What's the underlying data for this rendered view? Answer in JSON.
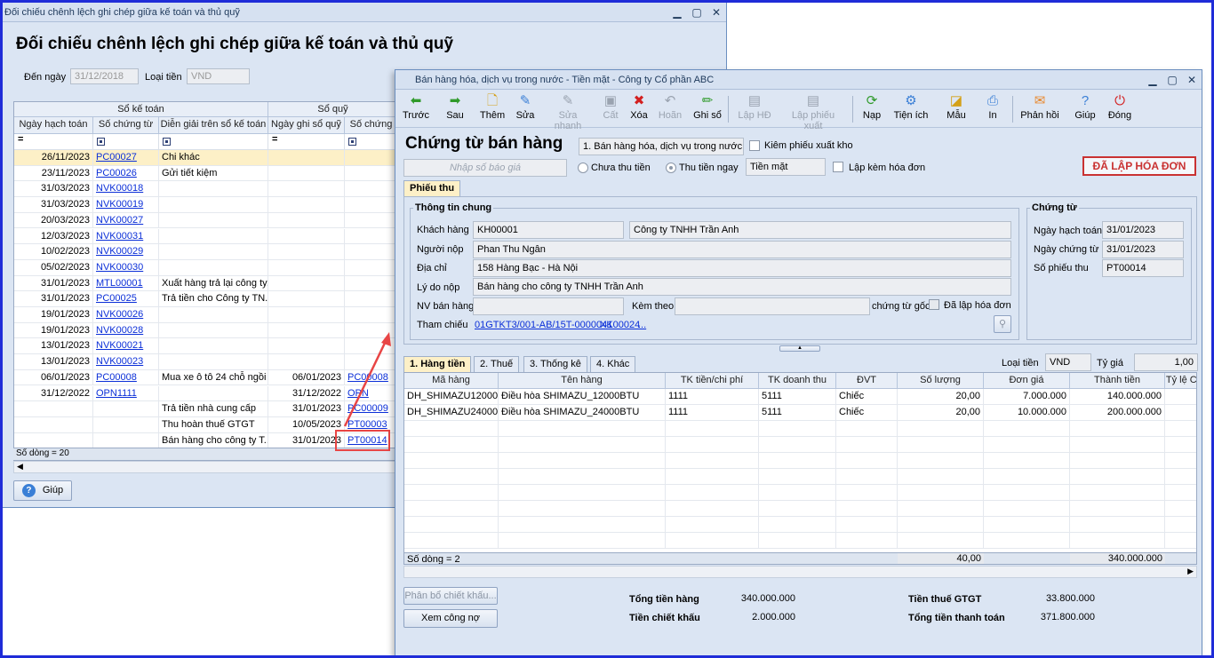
{
  "win1": {
    "title": "Đối chiếu chênh lệch ghi chép giữa kế toán và thủ quỹ",
    "heading": "Đối chiếu chênh lệch ghi chép giữa kế toán và thủ quỹ",
    "to_date_label": "Đến ngày",
    "to_date": "31/12/2018",
    "currency_label": "Loại tiền",
    "currency": "VND",
    "group_accounting": "Sổ kế toán",
    "group_cash": "Sổ quỹ",
    "columns": [
      "Ngày hạch toán",
      "Số chứng từ",
      "Diễn giải trên sổ kế toán",
      "Ngày ghi sổ quỹ",
      "Số chứng"
    ],
    "rows": [
      [
        "26/11/2023",
        "PC00027",
        "Chi khác",
        "",
        ""
      ],
      [
        "23/11/2023",
        "PC00026",
        "Gửi tiết kiệm",
        "",
        ""
      ],
      [
        "31/03/2023",
        "NVK00018",
        "",
        "",
        ""
      ],
      [
        "31/03/2023",
        "NVK00019",
        "",
        "",
        ""
      ],
      [
        "20/03/2023",
        "NVK00027",
        "",
        "",
        ""
      ],
      [
        "12/03/2023",
        "NVK00031",
        "",
        "",
        ""
      ],
      [
        "10/02/2023",
        "NVK00029",
        "",
        "",
        ""
      ],
      [
        "05/02/2023",
        "NVK00030",
        "",
        "",
        ""
      ],
      [
        "31/01/2023",
        "MTL00001",
        "Xuất hàng trả lại công ty...",
        "",
        ""
      ],
      [
        "31/01/2023",
        "PC00025",
        "Trả tiền cho Công ty TN...",
        "",
        ""
      ],
      [
        "19/01/2023",
        "NVK00026",
        "",
        "",
        ""
      ],
      [
        "19/01/2023",
        "NVK00028",
        "",
        "",
        ""
      ],
      [
        "13/01/2023",
        "NVK00021",
        "",
        "",
        ""
      ],
      [
        "13/01/2023",
        "NVK00023",
        "",
        "",
        ""
      ],
      [
        "06/01/2023",
        "PC00008",
        "Mua xe ô tô 24 chỗ ngồi",
        "06/01/2023",
        "PC00008"
      ],
      [
        "31/12/2022",
        "OPN1111",
        "",
        "31/12/2022",
        "OPN"
      ],
      [
        "",
        "",
        "Trả tiền nhà cung cấp",
        "31/01/2023",
        "PC00009"
      ],
      [
        "",
        "",
        "Thu hoàn thuế GTGT",
        "10/05/2023",
        "PT00003"
      ],
      [
        "",
        "",
        "Bán hàng cho công ty T...",
        "31/01/2023",
        "PT00014"
      ]
    ],
    "row_count": "Số dòng = 20",
    "help": "Giúp"
  },
  "win2": {
    "title": "Bán hàng hóa, dịch vụ trong nước - Tiền mặt - Công ty Cổ phần ABC",
    "toolbar": [
      "Trước",
      "Sau",
      "Thêm",
      "Sửa",
      "Sửa nhanh",
      "Cất",
      "Xóa",
      "Hoãn",
      "Ghi sổ",
      "Lập HĐ",
      "Lập phiếu xuất",
      "Nạp",
      "Tiện ích",
      "Mẫu",
      "In",
      "Phản hồi",
      "Giúp",
      "Đóng"
    ],
    "heading": "Chứng từ bán hàng",
    "type": "1. Bán hàng hóa, dịch vụ trong nước",
    "chk_export": "Kiêm phiếu xuất kho",
    "quote_placeholder": "Nhập số báo giá",
    "opt_unpaid": "Chưa thu tiền",
    "opt_paid": "Thu tiền ngay",
    "pay_method": "Tiền mặt",
    "chk_invoice": "Lập kèm hóa đơn",
    "badge": "ĐÃ LẬP HÓA ĐƠN",
    "tab_receipt": "Phiếu thu",
    "general_info": "Thông tin chung",
    "voucher": "Chứng từ",
    "customer_label": "Khách hàng",
    "customer_code": "KH00001",
    "customer_name": "Công ty TNHH Trần Anh",
    "payer_label": "Người nộp",
    "payer": "Phan Thu Ngân",
    "address_label": "Địa chỉ",
    "address": "158 Hàng Bạc - Hà Nội",
    "reason_label": "Lý do nộp",
    "reason": "Bán hàng cho công ty TNHH Trần Anh",
    "seller_label": "NV bán hàng",
    "attach_label": "Kèm theo",
    "orig_doc": "chứng từ gốc",
    "invoiced": "Đã lập hóa đơn",
    "ref_label": "Tham chiếu",
    "ref1": "01GTKT3/001-AB/15T-0000041",
    "ref2": "XK00024",
    "ref3": "...",
    "post_date_label": "Ngày hạch toán",
    "post_date": "31/01/2023",
    "doc_date_label": "Ngày chứng từ",
    "doc_date": "31/01/2023",
    "rec_no_label": "Số phiếu thu",
    "rec_no": "PT00014",
    "tabs": [
      "1. Hàng tiền",
      "2. Thuế",
      "3. Thống kê",
      "4. Khác"
    ],
    "cur_label": "Loại tiền",
    "cur": "VND",
    "rate_label": "Tỷ giá",
    "rate": "1,00",
    "columns": [
      "Mã hàng",
      "Tên hàng",
      "TK tiền/chi phí",
      "TK doanh thu",
      "ĐVT",
      "Số lượng",
      "Đơn giá",
      "Thành tiền",
      "Tỷ lệ Cl"
    ],
    "items": [
      [
        "DH_SHIMAZU12000",
        "Điều hòa SHIMAZU_12000BTU",
        "1111",
        "5111",
        "Chiếc",
        "20,00",
        "7.000.000",
        "140.000.000",
        ""
      ],
      [
        "DH_SHIMAZU24000",
        "Điều hòa SHIMAZU_24000BTU",
        "1111",
        "5111",
        "Chiếc",
        "20,00",
        "10.000.000",
        "200.000.000",
        ""
      ]
    ],
    "row_count": "Số dòng = 2",
    "qty_total": "40,00",
    "amount_total": "340.000.000",
    "btn_discount": "Phân bổ chiết khấu...",
    "btn_debt": "Xem công nợ",
    "sum_goods_label": "Tổng tiền hàng",
    "sum_goods": "340.000.000",
    "sum_disc_label": "Tiền chiết khấu",
    "sum_disc": "2.000.000",
    "sum_vat_label": "Tiền thuế GTGT",
    "sum_vat": "33.800.000",
    "sum_total_label": "Tổng tiền thanh toán",
    "sum_total": "371.800.000"
  }
}
